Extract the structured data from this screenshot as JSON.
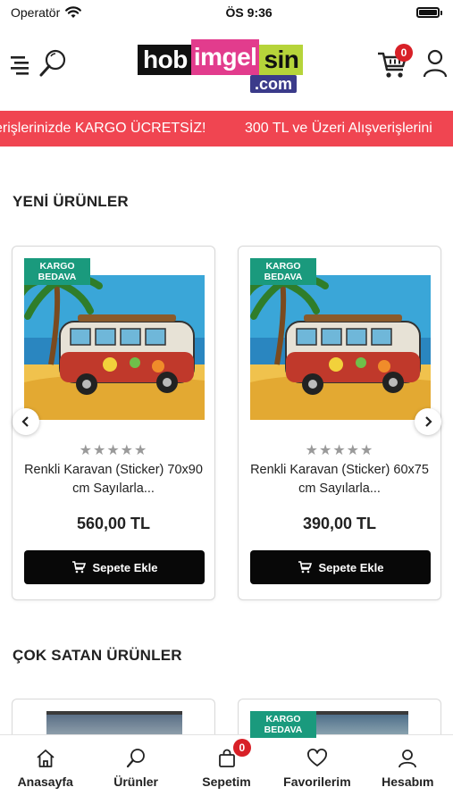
{
  "status_bar": {
    "carrier": "Operatör",
    "time": "ÖS 9:36"
  },
  "header": {
    "logo": {
      "part1": "hob",
      "part2": "imgel",
      "part3": "sin",
      "domain": ".com"
    },
    "cart_count": "0"
  },
  "marquee": {
    "items": [
      "erişlerinizde KARGO ÜCRETSİZ!",
      "300 TL ve Üzeri Alışverişlerini"
    ]
  },
  "sections": {
    "new_products": "YENİ ÜRÜNLER",
    "best_sellers": "ÇOK SATAN ÜRÜNLER"
  },
  "products": [
    {
      "badge_line1": "KARGO",
      "badge_line2": "BEDAVA",
      "name": "Renkli Karavan (Sticker) 70x90 cm Sayılarla...",
      "price": "560,00 TL",
      "rating": 0,
      "button": "Sepete Ekle"
    },
    {
      "badge_line1": "KARGO",
      "badge_line2": "BEDAVA",
      "name": "Renkli Karavan (Sticker) 60x75 cm Sayılarla...",
      "price": "390,00 TL",
      "rating": 0,
      "button": "Sepete Ekle"
    }
  ],
  "best_sellers_preview": {
    "badge_line1": "KARGO",
    "badge_line2": "BEDAVA"
  },
  "stars": "★★★★★",
  "tabbar": {
    "items": [
      {
        "label": "Anasayfa",
        "icon": "home-icon"
      },
      {
        "label": "Ürünler",
        "icon": "search-icon"
      },
      {
        "label": "Sepetim",
        "icon": "bag-icon",
        "badge": "0"
      },
      {
        "label": "Favorilerim",
        "icon": "heart-icon"
      },
      {
        "label": "Hesabım",
        "icon": "user-icon"
      }
    ]
  },
  "colors": {
    "accent_red": "#f04551",
    "badge_green": "#1a9a7d",
    "button_black": "#080808"
  }
}
